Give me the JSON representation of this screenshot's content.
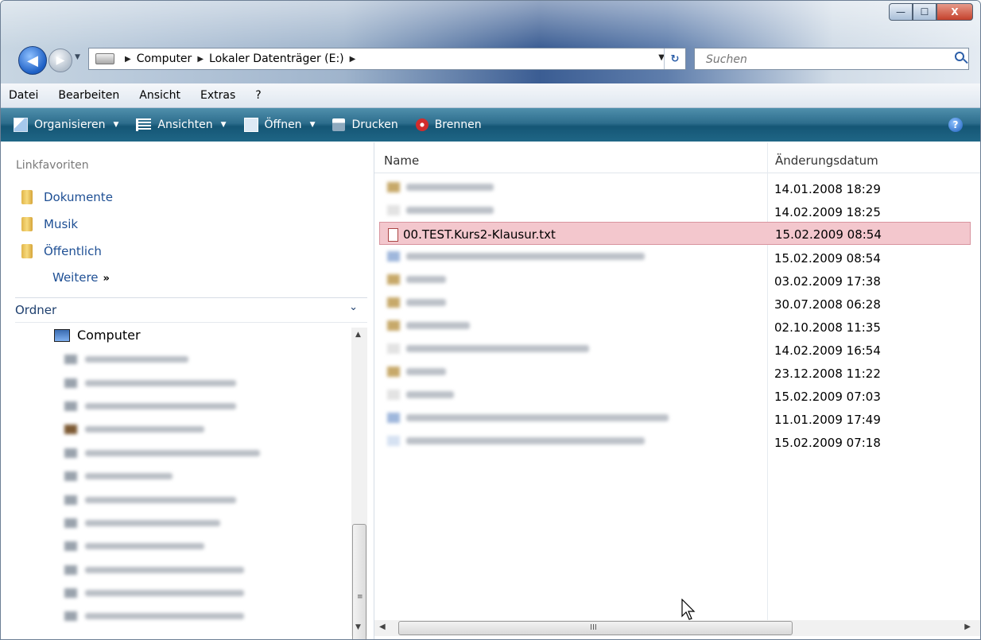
{
  "window": {
    "buttons": {
      "minimize": "—",
      "maximize": "☐",
      "close": "X"
    }
  },
  "address": {
    "crumbs": [
      "Computer",
      "Lokaler Datenträger (E:)"
    ]
  },
  "search": {
    "placeholder": "Suchen"
  },
  "menu": [
    "Datei",
    "Bearbeiten",
    "Ansicht",
    "Extras",
    "?"
  ],
  "toolbar": {
    "organize": "Organisieren",
    "views": "Ansichten",
    "open": "Öffnen",
    "print": "Drucken",
    "burn": "Brennen",
    "help": "?"
  },
  "sidebar": {
    "favorites_title": "Linkfavoriten",
    "favorites": [
      "Dokumente",
      "Musik",
      "Öffentlich"
    ],
    "more": "Weitere",
    "more_glyph": "»",
    "folders_title": "Ordner",
    "tree_root": "Computer"
  },
  "list": {
    "columns": {
      "name": "Name",
      "date": "Änderungsdatum"
    },
    "selected_file": "00.TEST.Kurs2-Klausur.txt",
    "dates": [
      "14.01.2008 18:29",
      "14.02.2009 18:25",
      "15.02.2009 08:54",
      "15.02.2009 08:54",
      "03.02.2009 17:38",
      "30.07.2008 06:28",
      "02.10.2008 11:35",
      "14.02.2009 16:54",
      "23.12.2008 11:22",
      "15.02.2009 07:03",
      "11.01.2009 17:49",
      "15.02.2009 07:18"
    ]
  },
  "scroll": {
    "grip": "III",
    "grip_v": "≡"
  }
}
